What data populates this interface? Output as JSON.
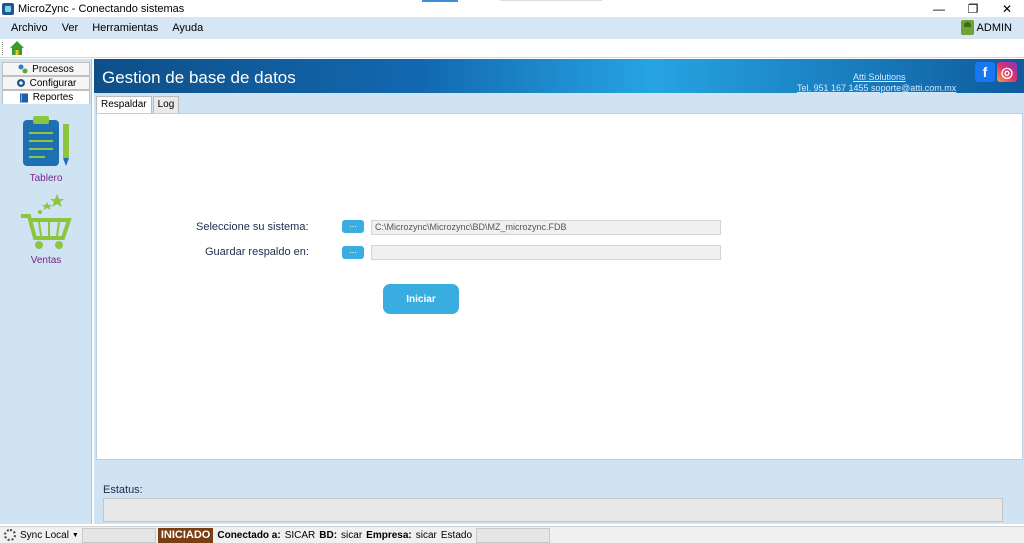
{
  "window": {
    "title": "MicroZync - Conectando sistemas",
    "minimize": "—",
    "restore": "❐",
    "close": "✕"
  },
  "menu": {
    "items": [
      "Archivo",
      "Ver",
      "Herramientas",
      "Ayuda"
    ],
    "user": "ADMIN"
  },
  "sidebar": {
    "nav": [
      {
        "label": "Procesos",
        "icon": "processes-icon"
      },
      {
        "label": "Configurar",
        "icon": "gear-icon"
      },
      {
        "label": "Reportes",
        "icon": "book-icon"
      }
    ],
    "tiles": [
      {
        "label": "Tablero",
        "icon": "clipboard-icon"
      },
      {
        "label": "Ventas",
        "icon": "shopping-cart-icon"
      }
    ]
  },
  "banner": {
    "title": "Gestion de base de datos",
    "company": "Atti Solutions",
    "contact": "Tel. 951 167 1455 soporte@atti.com.mx",
    "facebook": "f",
    "instagram": "◎"
  },
  "tabs": [
    "Respaldar",
    "Log"
  ],
  "form": {
    "system_label": "Seleccione su sistema:",
    "system_path": "C:\\Microzync\\Microzync\\BD\\MZ_microzync.FDB",
    "backup_label": "Guardar respaldo en:",
    "backup_path": "",
    "browse": "...",
    "start": "Iniciar"
  },
  "status": {
    "label": "Estatus:",
    "value": ""
  },
  "statusbar": {
    "sync": "Sync Local",
    "state": "INICIADO",
    "connected_label": "Conectado a:",
    "connected_value": "SICAR",
    "db_label": "BD:",
    "db_value": "sicar",
    "company_label": "Empresa:",
    "company_value": "sicar",
    "estado_label": "Estado"
  },
  "colors": {
    "accent": "#39ade0",
    "banner": "#1268b0",
    "panel": "#cfe3f3",
    "iniciado": "#7b3d14"
  }
}
